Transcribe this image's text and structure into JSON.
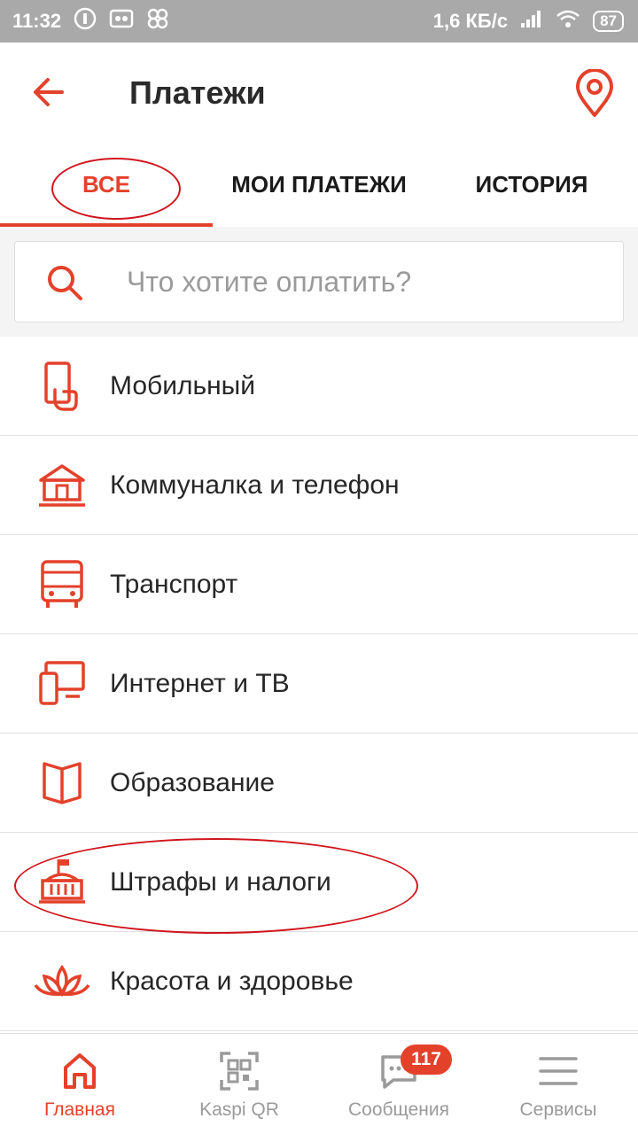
{
  "status_bar": {
    "time": "11:32",
    "network_speed": "1,6 КБ/с",
    "battery": "87"
  },
  "header": {
    "title": "Платежи",
    "icons": {
      "back": "arrow-left-icon",
      "location": "location-pin-icon"
    }
  },
  "tabs": [
    {
      "label": "ВСЕ",
      "active": true
    },
    {
      "label": "МОИ ПЛАТЕЖИ",
      "active": false
    },
    {
      "label": "ИСТОРИЯ",
      "active": false
    }
  ],
  "search": {
    "placeholder": "Что хотите оплатить?",
    "value": ""
  },
  "categories": [
    {
      "label": "Мобильный",
      "icon": "mobile-phone-icon"
    },
    {
      "label": "Коммуналка и телефон",
      "icon": "house-icon"
    },
    {
      "label": "Транспорт",
      "icon": "bus-icon"
    },
    {
      "label": "Интернет и ТВ",
      "icon": "tv-devices-icon"
    },
    {
      "label": "Образование",
      "icon": "book-icon"
    },
    {
      "label": "Штрафы и налоги",
      "icon": "government-building-icon"
    },
    {
      "label": "Красота и здоровье",
      "icon": "lotus-icon"
    }
  ],
  "bottom_nav": [
    {
      "label": "Главная",
      "icon": "home-icon",
      "active": true
    },
    {
      "label": "Kaspi QR",
      "icon": "qr-code-icon",
      "active": false
    },
    {
      "label": "Сообщения",
      "icon": "chat-icon",
      "active": false,
      "badge": "117"
    },
    {
      "label": "Сервисы",
      "icon": "menu-icon",
      "active": false
    }
  ],
  "colors": {
    "accent": "#e4412b",
    "annotation": "#d0141c",
    "status_bar": "#a9a9a9"
  }
}
